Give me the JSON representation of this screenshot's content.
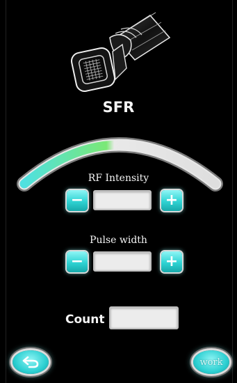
{
  "device": {
    "name": "SFR"
  },
  "gauge": {
    "level": 0.45,
    "fill_color": "#7be876",
    "track_color": "#4fe0e0"
  },
  "rf_intensity": {
    "label": "RF Intensity",
    "value": "",
    "decrease_symbol": "−",
    "increase_symbol": "+"
  },
  "pulse_width": {
    "label": "Pulse width",
    "value": "",
    "decrease_symbol": "−",
    "increase_symbol": "+"
  },
  "count": {
    "label": "Count",
    "value": ""
  },
  "footer": {
    "back_icon": "back-arrow-icon",
    "work_label": "work"
  }
}
